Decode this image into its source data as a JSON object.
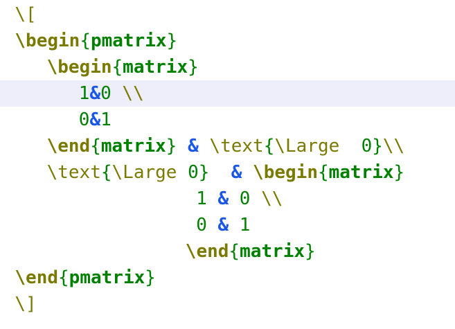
{
  "colors": {
    "background": "#ffffff",
    "current_line": "#eeeefb",
    "command": "#7a7a00",
    "brace": "#008000",
    "env_name": "#008000",
    "number": "#008000",
    "ampersand": "#1a56e8",
    "text": "#404040"
  },
  "editor": {
    "highlighted_line": 3,
    "lines": [
      {
        "indent": 1,
        "tokens": [
          {
            "text": "\\[",
            "role": "command"
          }
        ]
      },
      {
        "indent": 1,
        "tokens": [
          {
            "text": "\\begin",
            "role": "command",
            "bold": true
          },
          {
            "text": "{",
            "role": "brace"
          },
          {
            "text": "pmatrix",
            "role": "env_name",
            "bold": true
          },
          {
            "text": "}",
            "role": "brace"
          }
        ]
      },
      {
        "indent": 4,
        "tokens": [
          {
            "text": "\\begin",
            "role": "command",
            "bold": true
          },
          {
            "text": "{",
            "role": "brace"
          },
          {
            "text": "matrix",
            "role": "env_name",
            "bold": true
          },
          {
            "text": "}",
            "role": "brace"
          }
        ]
      },
      {
        "indent": 7,
        "tokens": [
          {
            "text": "1",
            "role": "number"
          },
          {
            "text": "&",
            "role": "ampersand",
            "bold": true
          },
          {
            "text": "0 ",
            "role": "number"
          },
          {
            "text": "\\\\",
            "role": "command"
          }
        ]
      },
      {
        "indent": 7,
        "tokens": [
          {
            "text": "0",
            "role": "number"
          },
          {
            "text": "&",
            "role": "ampersand",
            "bold": true
          },
          {
            "text": "1",
            "role": "number"
          }
        ]
      },
      {
        "indent": 4,
        "tokens": [
          {
            "text": "\\end",
            "role": "command",
            "bold": true
          },
          {
            "text": "{",
            "role": "brace"
          },
          {
            "text": "matrix",
            "role": "env_name",
            "bold": true
          },
          {
            "text": "}",
            "role": "brace"
          },
          {
            "text": " ",
            "role": "text"
          },
          {
            "text": "&",
            "role": "ampersand",
            "bold": true
          },
          {
            "text": " ",
            "role": "text"
          },
          {
            "text": "\\text",
            "role": "command"
          },
          {
            "text": "{",
            "role": "brace"
          },
          {
            "text": "\\Large",
            "role": "command"
          },
          {
            "text": "  0",
            "role": "number"
          },
          {
            "text": "}",
            "role": "brace"
          },
          {
            "text": "\\\\",
            "role": "command"
          }
        ]
      },
      {
        "indent": 4,
        "tokens": [
          {
            "text": "\\text",
            "role": "command"
          },
          {
            "text": "{",
            "role": "brace"
          },
          {
            "text": "\\Large",
            "role": "command"
          },
          {
            "text": " 0",
            "role": "number"
          },
          {
            "text": "}",
            "role": "brace"
          },
          {
            "text": "  ",
            "role": "text"
          },
          {
            "text": "&",
            "role": "ampersand",
            "bold": true
          },
          {
            "text": " ",
            "role": "text"
          },
          {
            "text": "\\begin",
            "role": "command",
            "bold": true
          },
          {
            "text": "{",
            "role": "brace"
          },
          {
            "text": "matrix",
            "role": "env_name",
            "bold": true
          },
          {
            "text": "}",
            "role": "brace"
          }
        ]
      },
      {
        "indent": 18,
        "tokens": [
          {
            "text": "1 ",
            "role": "number"
          },
          {
            "text": "&",
            "role": "ampersand",
            "bold": true
          },
          {
            "text": " 0 ",
            "role": "number"
          },
          {
            "text": "\\\\",
            "role": "command"
          }
        ]
      },
      {
        "indent": 18,
        "tokens": [
          {
            "text": "0 ",
            "role": "number"
          },
          {
            "text": "&",
            "role": "ampersand",
            "bold": true
          },
          {
            "text": " 1",
            "role": "number"
          }
        ]
      },
      {
        "indent": 17,
        "tokens": [
          {
            "text": "\\end",
            "role": "command",
            "bold": true
          },
          {
            "text": "{",
            "role": "brace"
          },
          {
            "text": "matrix",
            "role": "env_name",
            "bold": true
          },
          {
            "text": "}",
            "role": "brace"
          }
        ]
      },
      {
        "indent": 1,
        "tokens": [
          {
            "text": "\\end",
            "role": "command",
            "bold": true
          },
          {
            "text": "{",
            "role": "brace"
          },
          {
            "text": "pmatrix",
            "role": "env_name",
            "bold": true
          },
          {
            "text": "}",
            "role": "brace"
          }
        ]
      },
      {
        "indent": 1,
        "tokens": [
          {
            "text": "\\]",
            "role": "command"
          }
        ]
      }
    ]
  }
}
